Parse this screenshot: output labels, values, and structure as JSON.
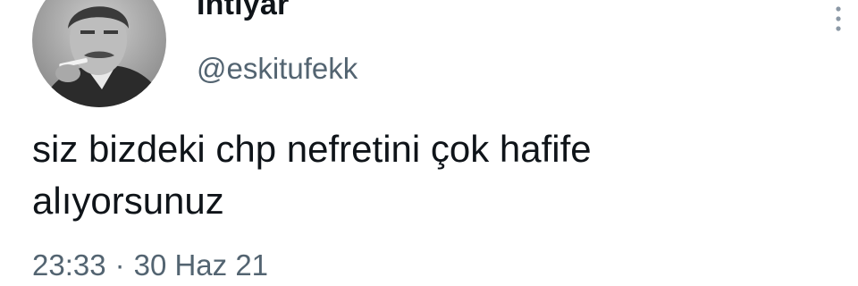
{
  "author": {
    "display_name": "İhtiyar",
    "handle": "@eskitufekk",
    "avatar_icon": "black-and-white-portrait-avatar"
  },
  "tweet": {
    "text_line_1": "siz bizdeki chp nefretini çok hafife",
    "text_line_2": "alıyorsunuz"
  },
  "meta": {
    "time": "23:33",
    "separator": "·",
    "date": "30 Haz 21"
  },
  "icons": {
    "more": "more-options-icon"
  },
  "colors": {
    "text_primary": "#0f1419",
    "text_secondary": "#536471",
    "background": "#ffffff"
  }
}
